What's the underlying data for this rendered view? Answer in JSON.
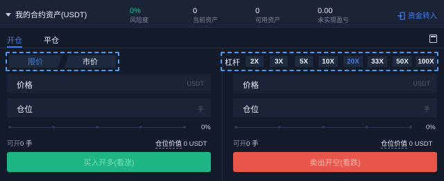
{
  "header": {
    "title": "我的合约资产(USDT)",
    "stats": [
      {
        "value": "0%",
        "label": "风险度"
      },
      {
        "value": "0",
        "label": "当前资产"
      },
      {
        "value": "0",
        "label": "可用资产"
      },
      {
        "value": "0.00",
        "label": "未实现盈亏"
      }
    ],
    "transfer_label": "资金转入"
  },
  "tabs": {
    "open": "开仓",
    "close": "平仓"
  },
  "order_type": {
    "limit": "限价",
    "market": "市价"
  },
  "leverage": {
    "label": "杠杆",
    "options": [
      "2X",
      "3X",
      "5X",
      "10X",
      "20X",
      "33X",
      "50X",
      "100X"
    ],
    "selected": "20X"
  },
  "buy_panel": {
    "price_label": "价格",
    "price_unit": "USDT",
    "qty_label": "仓位",
    "qty_unit": "手",
    "percent": "0%",
    "available_key": "可开",
    "available_value": "0 手",
    "position_value_key": "仓位价值",
    "position_value": "0 USDT",
    "submit": "买入开多(看涨)"
  },
  "sell_panel": {
    "price_label": "价格",
    "price_unit": "USDT",
    "qty_label": "仓位",
    "qty_unit": "手",
    "percent": "0%",
    "available_key": "可开",
    "available_value": "0 手",
    "position_value_key": "仓位价值",
    "position_value": "0 USDT",
    "submit": "卖出开空(看跌)"
  },
  "colors": {
    "accent": "#3d7cf0",
    "buy": "#1db583",
    "sell": "#e8564a",
    "background": "#141c2b"
  }
}
